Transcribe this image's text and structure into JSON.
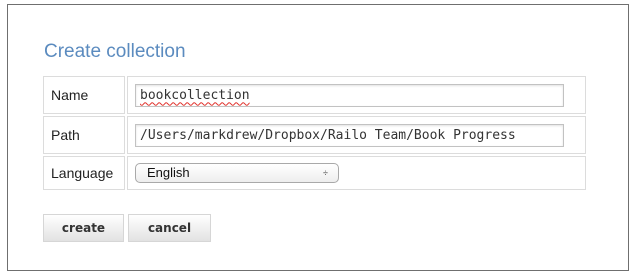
{
  "dialog": {
    "title": "Create collection"
  },
  "form": {
    "name": {
      "label": "Name",
      "value": "bookcollection"
    },
    "path": {
      "label": "Path",
      "value": "/Users/markdrew/Dropbox/Railo Team/Book Progress"
    },
    "language": {
      "label": "Language",
      "selected": "English",
      "arrows": "÷"
    }
  },
  "actions": {
    "create_label": "create",
    "cancel_label": "cancel"
  },
  "colors": {
    "title": "#5b8bbf",
    "spellcheck_underline": "#e0302a",
    "frame_border": "#6f6f6f"
  },
  "icons": {
    "select_arrows": "select-arrows-icon"
  }
}
